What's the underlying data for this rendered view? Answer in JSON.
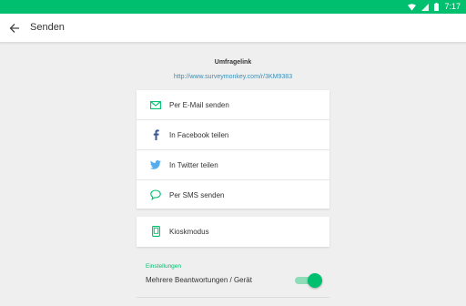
{
  "status_bar": {
    "time": "7:17",
    "color": "#00bf6f"
  },
  "app_bar": {
    "title": "Senden"
  },
  "survey_link": {
    "heading": "Umfragelink",
    "url": "http://www.surveymonkey.com/r/3KM9383"
  },
  "share_options": [
    {
      "label": "Per E-Mail senden",
      "icon": "mail-icon"
    },
    {
      "label": "In Facebook teilen",
      "icon": "facebook-icon"
    },
    {
      "label": "In Twitter teilen",
      "icon": "twitter-icon"
    },
    {
      "label": "Per SMS senden",
      "icon": "sms-icon"
    }
  ],
  "kiosk": {
    "label": "Kioskmodus",
    "icon": "tablet-icon"
  },
  "settings": {
    "section_label": "Einstellungen",
    "multiple_responses_label": "Mehrere Beantwortungen / Gerät",
    "multiple_responses_enabled": true
  },
  "colors": {
    "accent": "#00bf6f",
    "link": "#3a8fb7",
    "facebook": "#3b5998",
    "twitter": "#55acee"
  }
}
